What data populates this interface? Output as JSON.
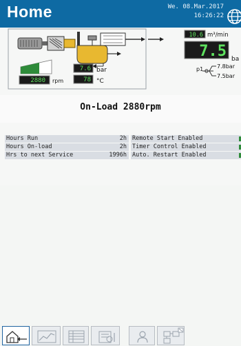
{
  "header": {
    "title": "Home",
    "date": "We. 08.Mar.2017",
    "time": "16:26:22",
    "icon": "globe-icon"
  },
  "readings": {
    "flow_value": "10.6",
    "flow_unit": "m³/min",
    "pressure_value": "7.5",
    "pressure_unit": "ba",
    "p1_label": "p1",
    "p1_high": "7.8bar",
    "p1_low": "7.5bar",
    "motor_pressure_value": "7.6",
    "motor_pressure_unit": "bar",
    "temperature_value": "78",
    "temperature_unit": "°C",
    "speed_value": "2880",
    "speed_unit": "rpm",
    "speed_level": 0.6
  },
  "status": {
    "text": "On-Load 2880rpm"
  },
  "table": {
    "left": [
      {
        "label": "Hours Run",
        "value": "2h"
      },
      {
        "label": "Hours On-load",
        "value": "2h"
      },
      {
        "label": "Hrs to next Service",
        "value": "1996h"
      }
    ],
    "right": [
      {
        "label": "Remote Start Enabled"
      },
      {
        "label": "Timer Control Enabled"
      },
      {
        "label": "Auto. Restart Enabled"
      }
    ]
  },
  "toolbar": {
    "buttons": [
      {
        "icon": "home-back-icon"
      },
      {
        "icon": "chart-icon"
      },
      {
        "icon": "list-icon"
      },
      {
        "icon": "maintenance-icon"
      },
      {
        "icon": "user-icon"
      },
      {
        "icon": "network-icon"
      }
    ]
  },
  "colors": {
    "header_bg": "#0e6aa3",
    "display_bg": "#1a1a1a",
    "display_text": "#5ee25e",
    "gauge_green": "#2e8b3a",
    "row_bg": "#d9dde3"
  }
}
